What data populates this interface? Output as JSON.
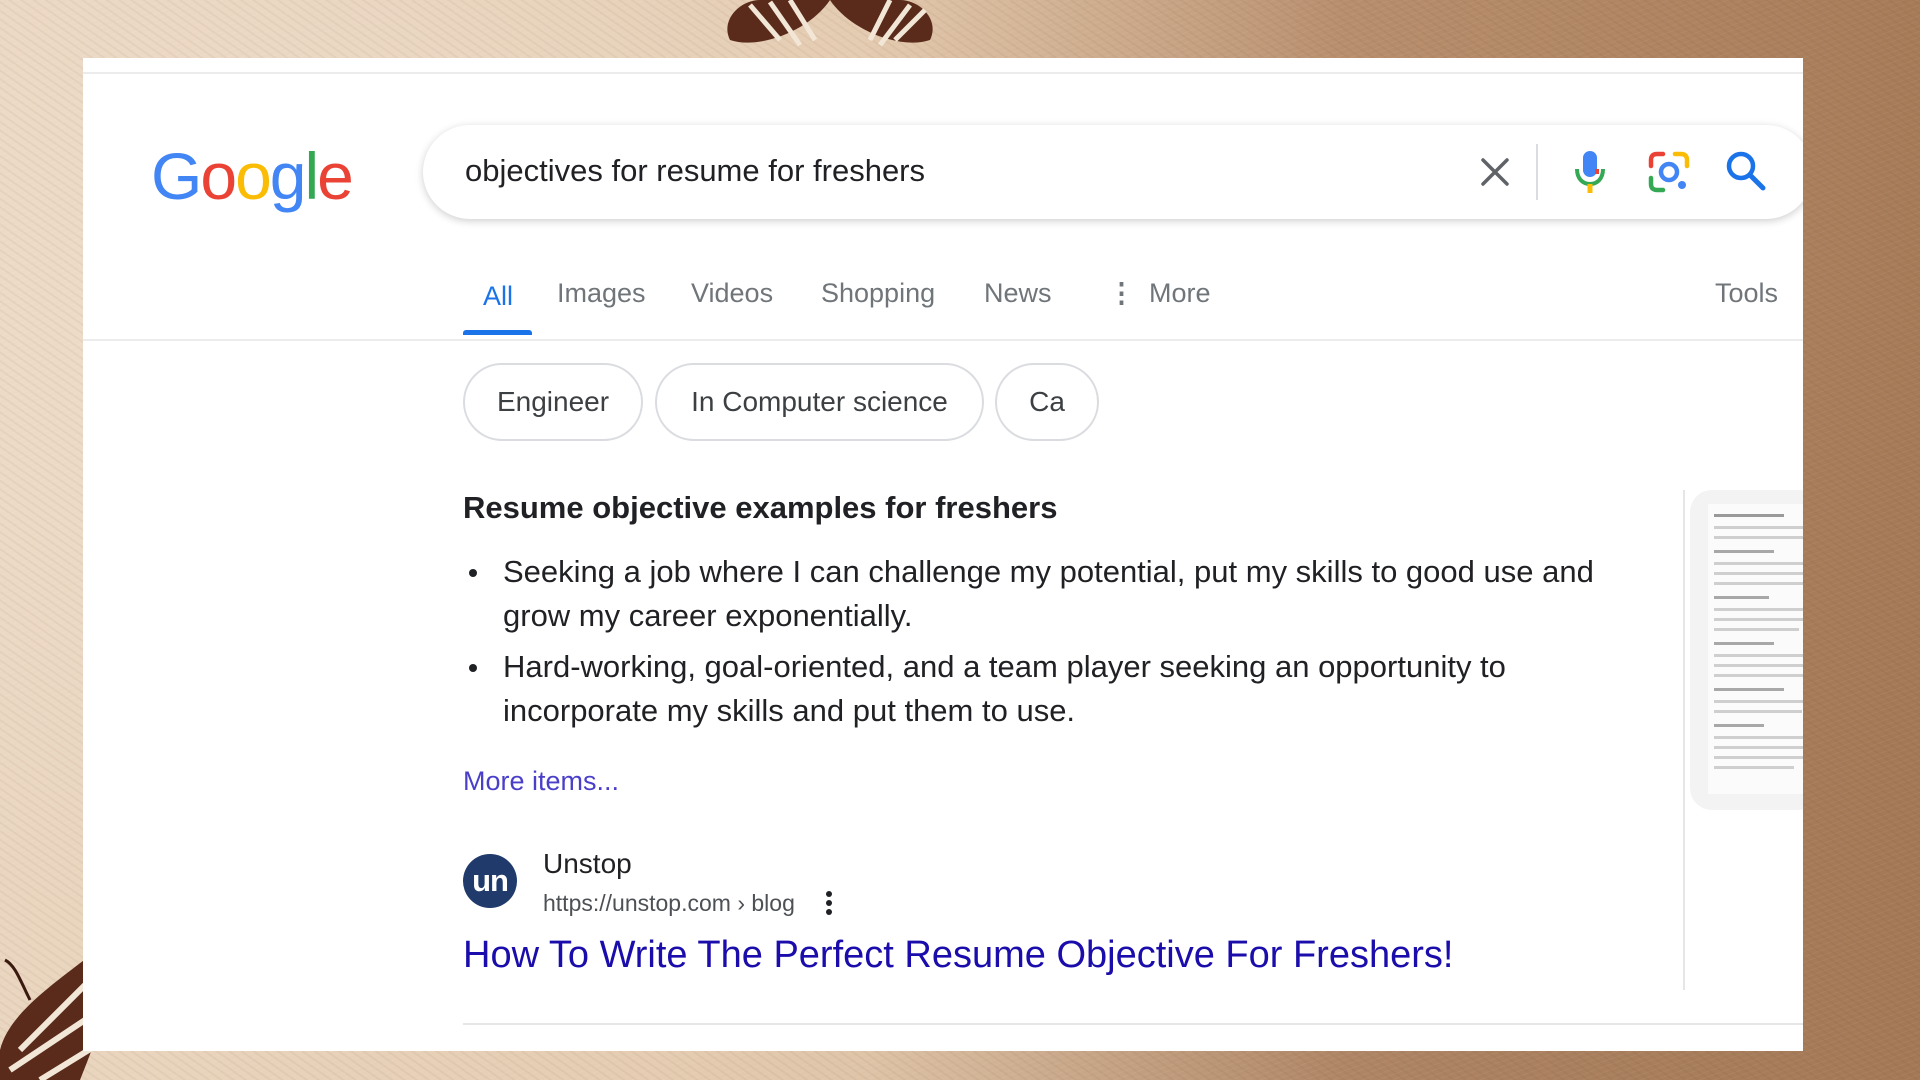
{
  "google": {
    "logo_letters": [
      {
        "char": "G",
        "color": "#4285F4"
      },
      {
        "char": "o",
        "color": "#EA4335"
      },
      {
        "char": "o",
        "color": "#FBBC05"
      },
      {
        "char": "g",
        "color": "#4285F4"
      },
      {
        "char": "l",
        "color": "#34A853"
      },
      {
        "char": "e",
        "color": "#EA4335"
      }
    ]
  },
  "search": {
    "query": "objectives for resume for freshers",
    "icons": [
      "close-icon",
      "microphone-icon",
      "google-lens-icon",
      "search-icon"
    ]
  },
  "tabs": {
    "items": [
      "All",
      "Images",
      "Videos",
      "Shopping",
      "News",
      "More"
    ],
    "active": "All",
    "tools_label": "Tools",
    "more_icon": "vertical-dots-icon"
  },
  "chips": [
    "Engineer",
    "In Computer science",
    "Ca"
  ],
  "featured_snippet": {
    "title": "Resume objective examples for freshers",
    "bullets": [
      "Seeking a job where I can challenge my potential, put my skills to good use and grow my career exponentially.",
      "Hard-working, goal-oriented, and a team player seeking an opportunity to incorporate my skills and put them to use."
    ],
    "more_items_label": "More items..."
  },
  "result": {
    "favicon_text": "un",
    "site_name": "Unstop",
    "url": "https://unstop.com › blog",
    "title": "How To Write The Perfect Resume Objective For Freshers!"
  },
  "colors": {
    "link_blue": "#1a0dab",
    "active_tab": "#1a73e8",
    "more_items": "#4a3fc9",
    "favicon_bg": "#1f3a6b"
  }
}
